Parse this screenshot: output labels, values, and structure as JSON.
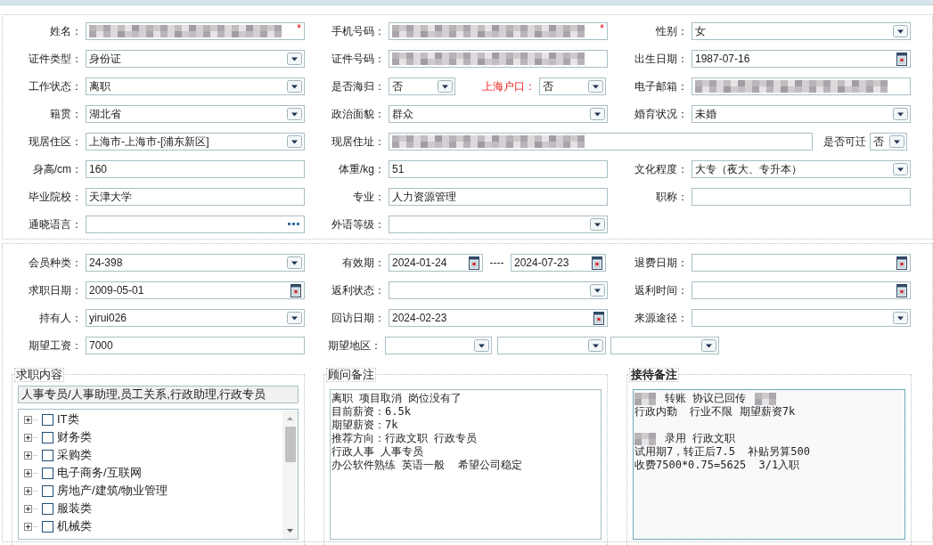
{
  "top_section": {
    "rows": [
      [
        {
          "label": "姓名：",
          "kind": "text",
          "redacted": true,
          "required_mark": "*"
        },
        {
          "label": "手机号码：",
          "kind": "text",
          "redacted": true,
          "required_mark": "*"
        },
        {
          "label": "性别：",
          "kind": "select",
          "value": "女"
        }
      ],
      [
        {
          "label": "证件类型：",
          "kind": "select",
          "value": "身份证"
        },
        {
          "label": "证件号码：",
          "kind": "text",
          "redacted": true
        },
        {
          "label": "出生日期：",
          "kind": "date",
          "value": "1987-07-16"
        }
      ],
      [
        {
          "label": "工作状态：",
          "kind": "select",
          "value": "离职"
        },
        {
          "label": "是否海归：",
          "kind": "select",
          "value": "否"
        },
        {
          "label": "上海户口：",
          "kind": "select",
          "value": "否",
          "highlight": true
        },
        {
          "label": "电子邮箱：",
          "kind": "text",
          "redacted": true
        }
      ],
      [
        {
          "label": "籍贯：",
          "kind": "select",
          "value": "湖北省"
        },
        {
          "label": "政治面貌：",
          "kind": "select",
          "value": "群众"
        },
        {
          "label": "婚育状况：",
          "kind": "select",
          "value": "未婚"
        }
      ],
      [
        {
          "label": "现居住区：",
          "kind": "select",
          "value": "上海市-上海市-[浦东新区]"
        },
        {
          "label": "现居住址：",
          "kind": "text",
          "redacted": true
        },
        {
          "label": "是否可迁",
          "kind": "select",
          "value": "否"
        }
      ],
      [
        {
          "label": "身高/cm：",
          "kind": "text",
          "value": "160"
        },
        {
          "label": "体重/kg：",
          "kind": "text",
          "value": "51"
        },
        {
          "label": "文化程度：",
          "kind": "select",
          "value": "大专（夜大、专升本）"
        }
      ],
      [
        {
          "label": "毕业院校：",
          "kind": "text",
          "value": "天津大学"
        },
        {
          "label": "专业：",
          "kind": "text",
          "value": "人力资源管理"
        },
        {
          "label": "职称：",
          "kind": "text"
        }
      ],
      [
        {
          "label": "通晓语言：",
          "kind": "picker"
        },
        {
          "label": "外语等级：",
          "kind": "select"
        }
      ]
    ]
  },
  "bottom_section": {
    "rows": [
      [
        {
          "label": "会员种类：",
          "kind": "select",
          "value": "24-398"
        },
        {
          "label": "有效期：",
          "kind": "date_range",
          "value": "2024-01-24",
          "separator": "----",
          "value_end": "2024-07-23"
        },
        {
          "label": "退费日期：",
          "kind": "date"
        }
      ],
      [
        {
          "label": "求职日期：",
          "kind": "date",
          "value": "2009-05-01"
        },
        {
          "label": "返利状态：",
          "kind": "select"
        },
        {
          "label": "返利时间：",
          "kind": "date"
        }
      ],
      [
        {
          "label": "持有人：",
          "kind": "select",
          "value": "yirui026"
        },
        {
          "label": "回访日期：",
          "kind": "date",
          "value": "2024-02-23"
        },
        {
          "label": "来源途径：",
          "kind": "select"
        }
      ],
      [
        {
          "label": "期望工资：",
          "kind": "text",
          "value": "7000"
        },
        {
          "label": "期望地区：",
          "kind": "select"
        },
        {
          "kind": "select"
        },
        {
          "kind": "select"
        }
      ]
    ]
  },
  "panels": [
    {
      "kind": "job_tree",
      "title": "求职内容",
      "summary": "人事专员/人事助理,员工关系,行政助理,行政专员",
      "items": [
        {
          "label": "IT类",
          "checked": false,
          "expanded": false
        },
        {
          "label": "财务类",
          "checked": false,
          "expanded": false
        },
        {
          "label": "采购类",
          "checked": false,
          "expanded": false
        },
        {
          "label": "电子商务/互联网",
          "checked": false,
          "expanded": false
        },
        {
          "label": "房地产/建筑/物业管理",
          "checked": false,
          "expanded": false
        },
        {
          "label": "服装类",
          "checked": false,
          "expanded": false
        },
        {
          "label": "机械类",
          "checked": false,
          "expanded": false
        }
      ]
    },
    {
      "kind": "notes",
      "title": "顾问备注",
      "focused": false,
      "lines": [
        {
          "text": "离职 项目取消 岗位没有了"
        },
        {
          "text": "目前薪资：6.5k"
        },
        {
          "text": "期望薪资：7k"
        },
        {
          "text": "推荐方向：行政文职 行政专员"
        },
        {
          "text": "行政人事 人事专员"
        },
        {
          "text": "办公软件熟练 英语一般  希望公司稳定"
        }
      ]
    },
    {
      "kind": "notes",
      "title": "接待备注",
      "focused": true,
      "lines": [
        {
          "text": "转账 协议已回传",
          "redacted_before": true,
          "redacted_after": true
        },
        {
          "text": "行政内勤  行业不限 期望薪资7k"
        },
        {
          "text": "录用 行政文职",
          "redacted_before": true,
          "gap_before": true
        },
        {
          "text": "试用期7，转正后7.5  补贴另算500"
        },
        {
          "text": "收费7500*0.75=5625  3/1入职"
        }
      ]
    }
  ]
}
